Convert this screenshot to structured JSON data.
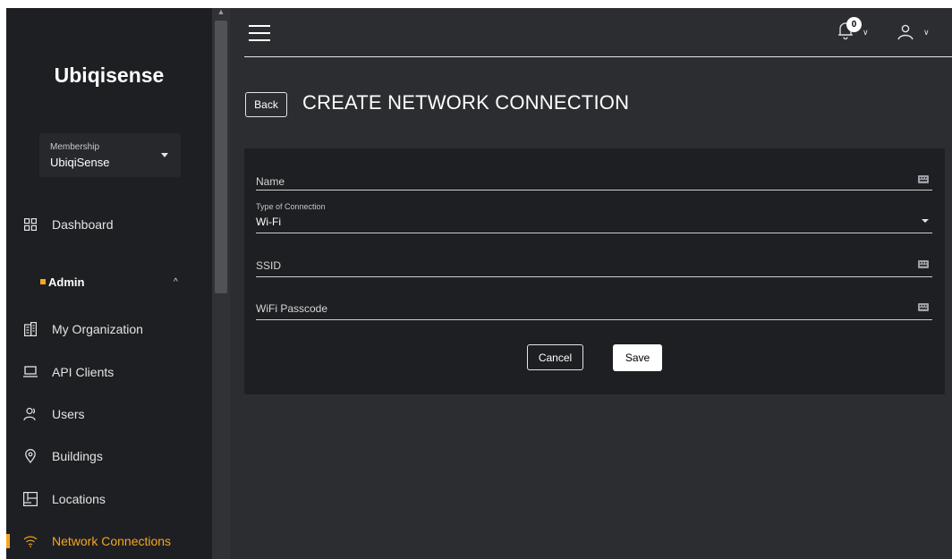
{
  "sidebar": {
    "brand": "Ubiqisense",
    "membership": {
      "label": "Membership",
      "value": "UbiqiSense"
    },
    "dashboard": {
      "label": "Dashboard",
      "icon": "grid-icon"
    },
    "admin": {
      "label": "Admin"
    },
    "items": [
      {
        "label": "My Organization",
        "icon": "building-icon"
      },
      {
        "label": "API Clients",
        "icon": "laptop-icon"
      },
      {
        "label": "Users",
        "icon": "users-icon"
      },
      {
        "label": "Buildings",
        "icon": "location-pin-icon"
      },
      {
        "label": "Locations",
        "icon": "floorplan-icon"
      },
      {
        "label": "Network Connections",
        "icon": "wifi-icon",
        "active": true
      }
    ]
  },
  "topbar": {
    "notification_count": "0"
  },
  "header": {
    "back_label": "Back",
    "title": "CREATE NETWORK CONNECTION"
  },
  "form": {
    "name": {
      "placeholder": "Name",
      "value": ""
    },
    "type": {
      "label": "Type of Connection",
      "value": "Wi-Fi"
    },
    "ssid": {
      "placeholder": "SSID",
      "value": ""
    },
    "passcode": {
      "placeholder": "WiFi Passcode",
      "value": ""
    },
    "cancel_label": "Cancel",
    "save_label": "Save"
  },
  "colors": {
    "accent": "#f5a623",
    "sidebar_bg": "#1e1f22",
    "main_bg": "#2b2d31"
  }
}
